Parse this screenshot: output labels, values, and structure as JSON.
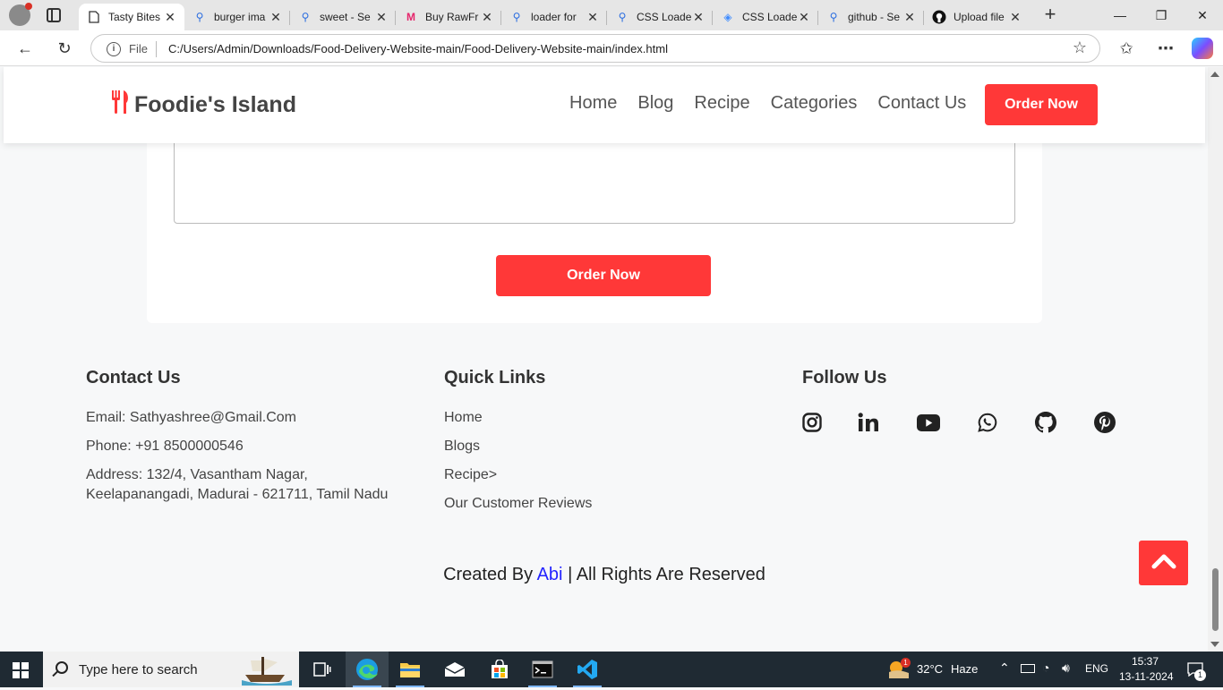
{
  "browser": {
    "tabs": [
      {
        "title": "Tasty Bites",
        "icon": "page-icon",
        "active": true
      },
      {
        "title": "burger ima",
        "icon": "search-icon"
      },
      {
        "title": "sweet - Se",
        "icon": "search-icon"
      },
      {
        "title": "Buy RawFr",
        "icon": "myntra-icon"
      },
      {
        "title": "loader for",
        "icon": "search-icon"
      },
      {
        "title": "CSS Loade",
        "icon": "search-icon"
      },
      {
        "title": "CSS Loade",
        "icon": "layers-icon"
      },
      {
        "title": "github - Se",
        "icon": "search-icon"
      },
      {
        "title": "Upload file",
        "icon": "github-icon"
      }
    ],
    "address": {
      "scheme_label": "File",
      "url": "C:/Users/Admin/Downloads/Food-Delivery-Website-main/Food-Delivery-Website-main/index.html"
    }
  },
  "site": {
    "logo_text": "Foodie's Island",
    "nav": [
      "Home",
      "Blog",
      "Recipe",
      "Categories",
      "Contact Us"
    ],
    "header_cta": "Order Now",
    "form_cta": "Order Now",
    "accent_color": "#ff3838"
  },
  "footer": {
    "contact": {
      "heading": "Contact Us",
      "email": "Email: Sathyashree@Gmail.Com",
      "phone": "Phone: +91 8500000546",
      "address": "Address: 132/4, Vasantham Nagar, Keelapanangadi, Madurai - 621711, Tamil Nadu"
    },
    "links": {
      "heading": "Quick Links",
      "items": [
        "Home",
        "Blogs",
        "Recipe>",
        "Our Customer Reviews"
      ]
    },
    "follow": {
      "heading": "Follow Us",
      "icons": [
        "instagram-icon",
        "linkedin-icon",
        "youtube-icon",
        "whatsapp-icon",
        "github-icon",
        "pinterest-icon"
      ]
    },
    "copyright": {
      "prefix": "Created By",
      "author": "Abi",
      "suffix": "| All Rights Are Reserved"
    }
  },
  "taskbar": {
    "search_placeholder": "Type here to search",
    "weather_badge": "1",
    "temperature": "32°C",
    "weather": "Haze",
    "language": "ENG",
    "time": "15:37",
    "date": "13-11-2024",
    "notification_count": "1"
  }
}
